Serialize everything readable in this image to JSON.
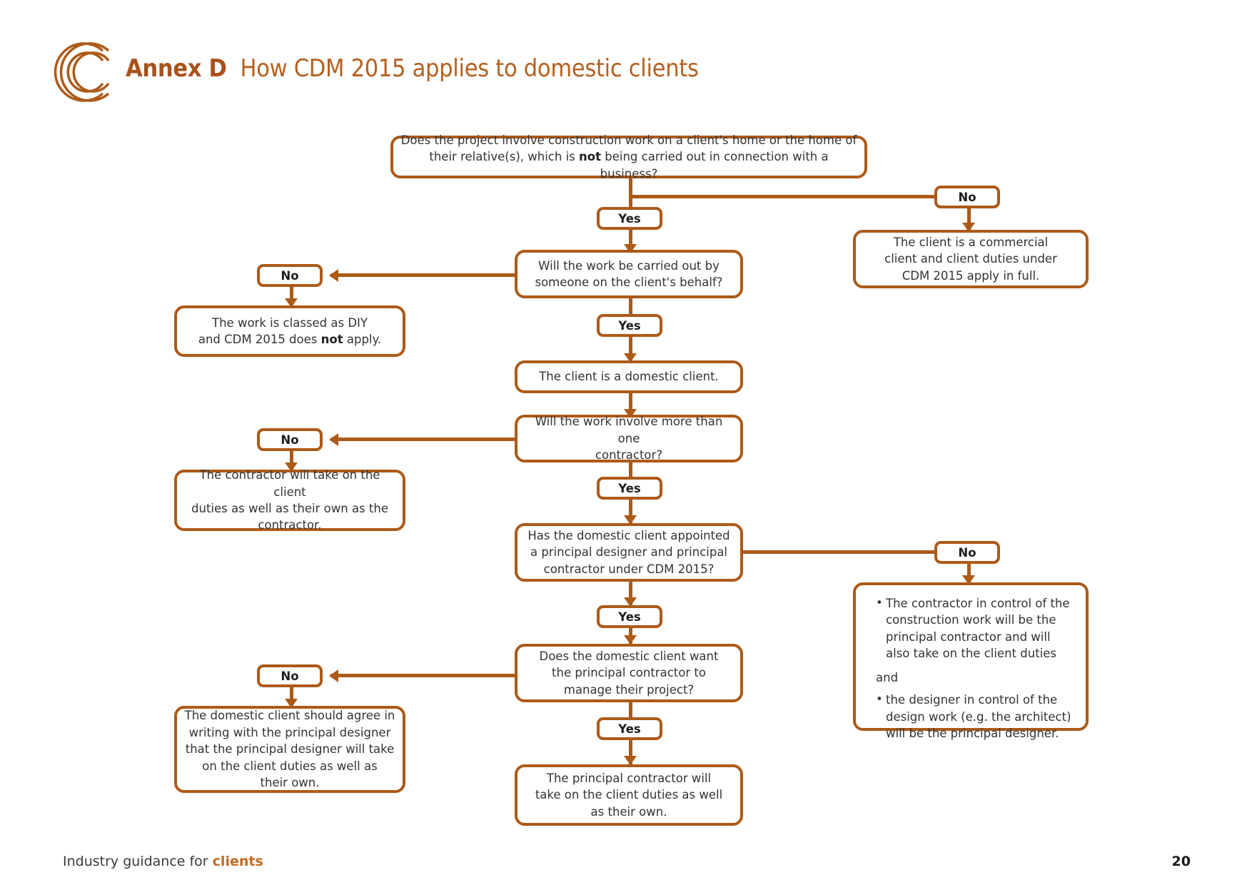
{
  "header": {
    "logo_icon": "concentric-c-logo",
    "annex_label": "Annex D",
    "title": "How CDM 2015 applies to domestic clients"
  },
  "footer": {
    "text_prefix": "Industry guidance for ",
    "text_highlight": "clients",
    "page_number": "20"
  },
  "flowchart": {
    "type": "decision-flowchart",
    "accent_color": "#AC5A18",
    "text_color": "#333333",
    "nodes": {
      "q1": {
        "label": "Does the project involve construction work on a client's home or the home of their relative(s), which is not being carried out in connection with a business?",
        "part1": "Does the project involve construction work on a client's home or the home of",
        "part2a": "their relative(s), which is ",
        "part2b": "not",
        "part2c": " being carried out in connection with a business?"
      },
      "q1_yes": {
        "label": "Yes"
      },
      "q1_no": {
        "label": "No"
      },
      "commercial": {
        "line1": "The client is a commercial",
        "line2": "client and client duties under",
        "line3": "CDM 2015 apply in full."
      },
      "q2": {
        "line1": "Will the work be carried out by",
        "line2": "someone on the client's behalf?"
      },
      "q2_no": {
        "label": "No"
      },
      "q2_yes": {
        "label": "Yes"
      },
      "diy": {
        "line1": "The work is classed as DIY",
        "line2a": "and CDM 2015 does ",
        "line2b": "not",
        "line2c": " apply."
      },
      "domestic": {
        "label": "The client is a domestic client."
      },
      "q3": {
        "line1": "Will the work involve more than one",
        "line2": "contractor?"
      },
      "q3_no": {
        "label": "No"
      },
      "q3_yes": {
        "label": "Yes"
      },
      "contractor_duties": {
        "line1": "The contractor will take on the client",
        "line2": "duties as well as their own as the",
        "line3": "contractor."
      },
      "q4": {
        "line1": "Has the domestic client appointed",
        "line2": "a principal designer and principal",
        "line3": "contractor under CDM 2015?"
      },
      "q4_no": {
        "label": "No"
      },
      "q4_yes": {
        "label": "Yes"
      },
      "no_appointment": {
        "bullet1": "The contractor in control of the construction work will be the principal contractor and will also take on the client duties",
        "conjunction": "and",
        "bullet2": "the designer in control of the design work (e.g. the architect) will be the principal designer."
      },
      "q5": {
        "line1": "Does the domestic client want",
        "line2": "the principal contractor to",
        "line3": "manage their project?"
      },
      "q5_no": {
        "label": "No"
      },
      "q5_yes": {
        "label": "Yes"
      },
      "designer_agreement": {
        "line1": "The domestic client should agree in",
        "line2": "writing with the principal designer",
        "line3": "that the principal designer will take",
        "line4": "on the client duties as well as",
        "line5": "their own."
      },
      "pc_duties": {
        "line1": "The principal contractor will",
        "line2": "take on the client duties as well",
        "line3": "as their own."
      }
    }
  }
}
